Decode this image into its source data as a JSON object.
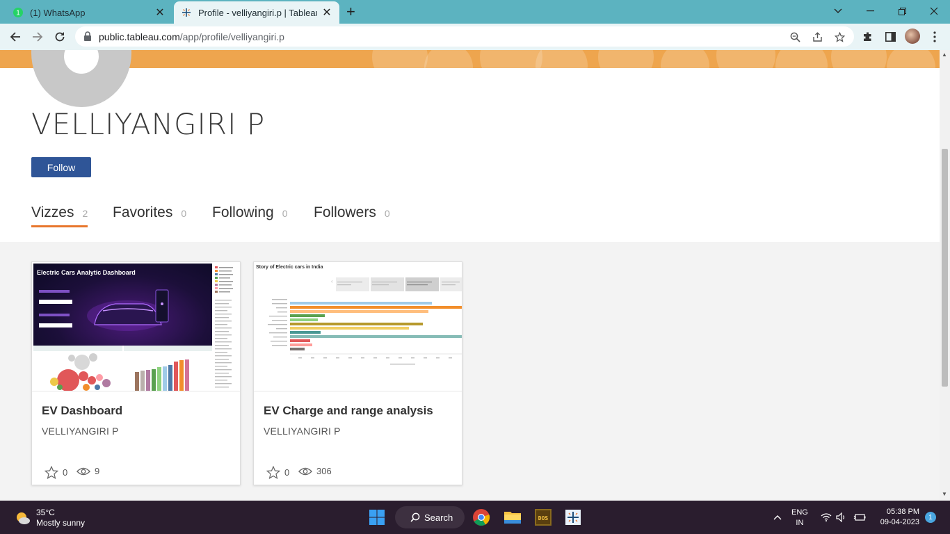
{
  "browser": {
    "tabs": [
      {
        "title": "(1) WhatsApp",
        "icon": "whatsapp-icon",
        "active": false
      },
      {
        "title": "Profile - velliyangiri.p | Tableau Pu",
        "icon": "tableau-icon",
        "active": true
      }
    ],
    "url_host": "public.tableau.com",
    "url_path": "/app/profile/velliyangiri.p"
  },
  "profile": {
    "name": "VELLIYANGIRI P",
    "follow_label": "Follow",
    "tabs": [
      {
        "label": "Vizzes",
        "count": "2",
        "active": true
      },
      {
        "label": "Favorites",
        "count": "0",
        "active": false
      },
      {
        "label": "Following",
        "count": "0",
        "active": false
      },
      {
        "label": "Followers",
        "count": "0",
        "active": false
      }
    ]
  },
  "vizzes": [
    {
      "title": "EV Dashboard",
      "author": "VELLIYANGIRI P",
      "favorites": "0",
      "views": "9",
      "thumb_title": "Electric Cars Analytic Dashboard"
    },
    {
      "title": "EV Charge and range analysis",
      "author": "VELLIYANGIRI P",
      "favorites": "0",
      "views": "306",
      "thumb_title": "Story of Electric cars in India"
    }
  ],
  "taskbar": {
    "temperature": "35°C",
    "weather": "Mostly sunny",
    "search_label": "Search",
    "lang_line1": "ENG",
    "lang_line2": "IN",
    "time": "05:38 PM",
    "date": "09-04-2023",
    "notifications": "1"
  },
  "colors": {
    "banner": "#eea54e",
    "follow_button": "#2f5597",
    "active_tab_underline": "#e8762c",
    "tab_strip": "#5cb3c0"
  }
}
